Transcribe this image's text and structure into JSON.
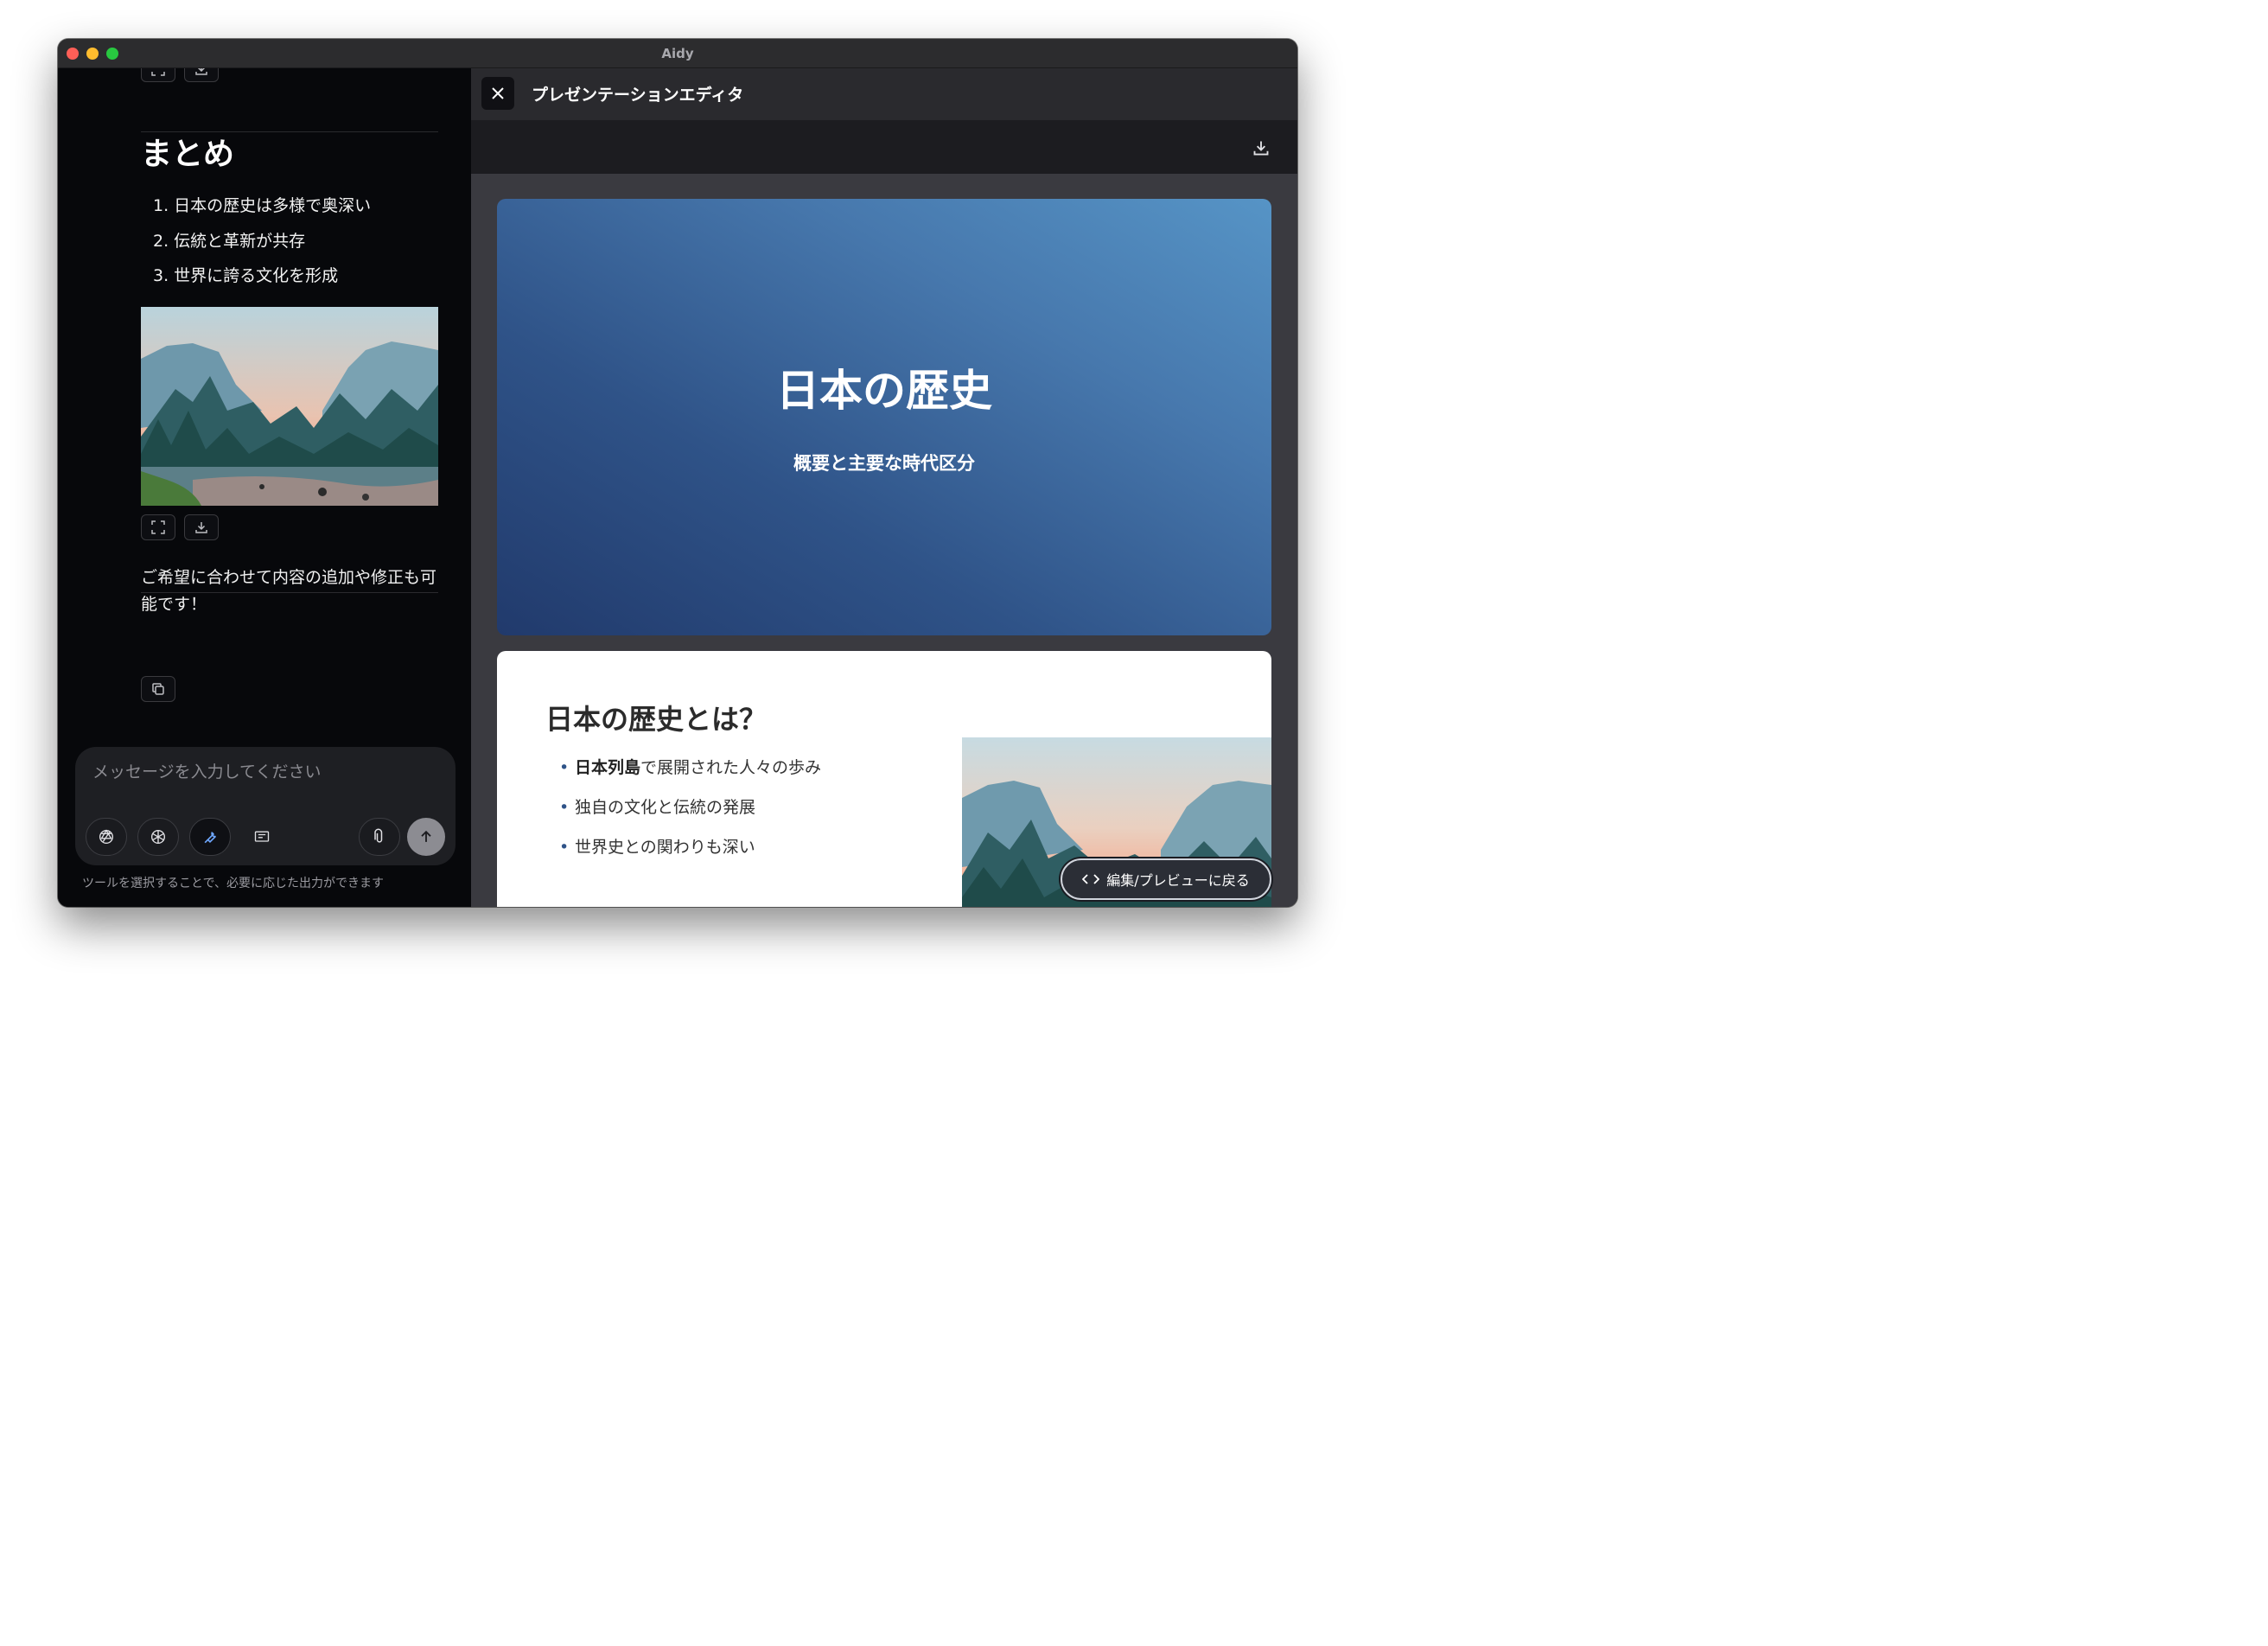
{
  "window": {
    "title": "Aidy"
  },
  "chat": {
    "summary_title": "まとめ",
    "summary_items": [
      "1. 日本の歴史は多様で奥深い",
      "2. 伝統と革新が共存",
      "3. 世界に誇る文化を形成"
    ],
    "message": "ご希望に合わせて内容の追加や修正も可能です！",
    "composer_placeholder": "メッセージを入力してください",
    "hint": "ツールを選択することで、必要に応じた出力ができます"
  },
  "editor": {
    "title": "プレゼンテーションエディタ",
    "slide1": {
      "title": "日本の歴史",
      "subtitle": "概要と主要な時代区分"
    },
    "slide2": {
      "title": "日本の歴史とは？",
      "item1_bold": "日本列島",
      "item1_rest": "で展開された人々の歩み",
      "item2": "独自の文化と伝統の発展",
      "item3": "世界史との関わりも深い"
    },
    "back_button": "編集/プレビューに戻る"
  },
  "icons": {
    "expand": "expand-icon",
    "download": "download-icon",
    "copy": "copy-icon",
    "openai": "openai-icon",
    "perplexity": "perplexity-icon",
    "tool": "wrench-icon",
    "slides": "presentation-icon",
    "attach": "paperclip-icon",
    "send": "arrow-up-icon",
    "close": "close-icon",
    "code": "code-icon"
  }
}
